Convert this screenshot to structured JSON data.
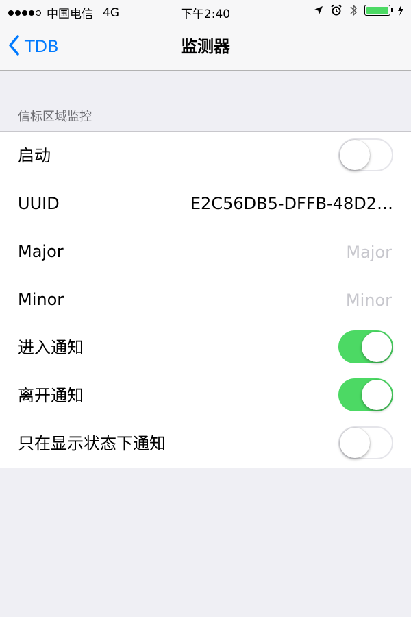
{
  "status_bar": {
    "signal_dots": [
      true,
      true,
      true,
      true,
      false
    ],
    "carrier": "中国电信",
    "network": "4G",
    "time": "下午2:40",
    "icons": [
      "location-arrow-icon",
      "alarm-clock-icon",
      "bluetooth-icon",
      "battery-icon",
      "charging-bolt-icon"
    ],
    "battery_level": 1.0
  },
  "nav": {
    "back_label": "TDB",
    "title": "监测器"
  },
  "section": {
    "header": "信标区域监控"
  },
  "rows": [
    {
      "label": "启动",
      "type": "toggle",
      "on": false
    },
    {
      "label": "UUID",
      "type": "value",
      "value": "E2C56DB5-DFFB-48D2…"
    },
    {
      "label": "Major",
      "type": "input",
      "value": "",
      "placeholder": "Major"
    },
    {
      "label": "Minor",
      "type": "input",
      "value": "",
      "placeholder": "Minor"
    },
    {
      "label": "进入通知",
      "type": "toggle",
      "on": true
    },
    {
      "label": "离开通知",
      "type": "toggle",
      "on": true
    },
    {
      "label": "只在显示状态下通知",
      "type": "toggle",
      "on": false
    }
  ],
  "colors": {
    "accent": "#007aff",
    "toggle_on": "#4cd964",
    "background": "#efeff4",
    "placeholder": "#c7c7cd"
  }
}
